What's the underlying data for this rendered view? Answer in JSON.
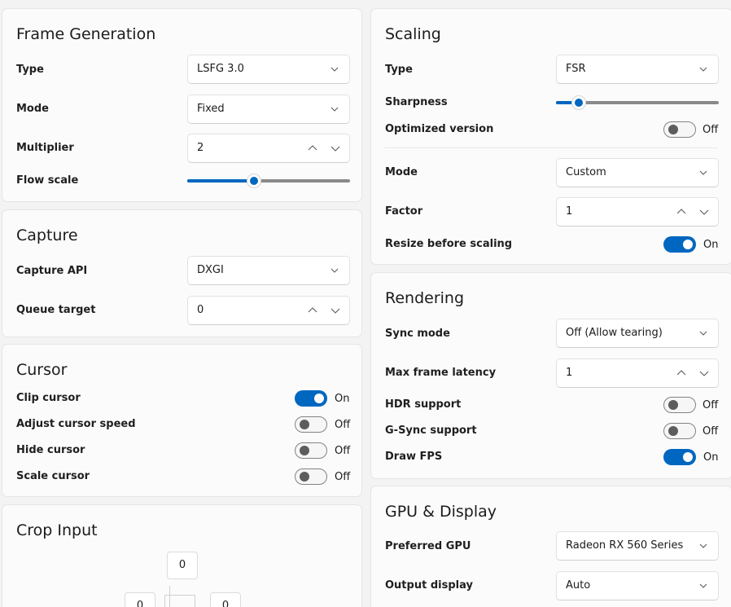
{
  "frame_generation": {
    "title": "Frame Generation",
    "type_label": "Type",
    "type_value": "LSFG 3.0",
    "mode_label": "Mode",
    "mode_value": "Fixed",
    "multiplier_label": "Multiplier",
    "multiplier_value": "2",
    "flow_scale_label": "Flow scale",
    "flow_scale_fraction": 0.41
  },
  "capture": {
    "title": "Capture",
    "api_label": "Capture API",
    "api_value": "DXGI",
    "queue_label": "Queue target",
    "queue_value": "0"
  },
  "cursor": {
    "title": "Cursor",
    "clip_label": "Clip cursor",
    "clip_state": "On",
    "adjust_label": "Adjust cursor speed",
    "adjust_state": "Off",
    "hide_label": "Hide cursor",
    "hide_state": "Off",
    "scale_label": "Scale cursor",
    "scale_state": "Off"
  },
  "crop_input": {
    "title": "Crop Input",
    "top_value": "0",
    "left_value": "0",
    "right_value": "0"
  },
  "scaling": {
    "title": "Scaling",
    "type_label": "Type",
    "type_value": "FSR",
    "sharpness_label": "Sharpness",
    "sharpness_fraction": 0.14,
    "optimized_label": "Optimized version",
    "optimized_state": "Off",
    "mode_label": "Mode",
    "mode_value": "Custom",
    "factor_label": "Factor",
    "factor_value": "1",
    "resize_label": "Resize before scaling",
    "resize_state": "On"
  },
  "rendering": {
    "title": "Rendering",
    "sync_label": "Sync mode",
    "sync_value": "Off (Allow tearing)",
    "latency_label": "Max frame latency",
    "latency_value": "1",
    "hdr_label": "HDR support",
    "hdr_state": "Off",
    "gsync_label": "G-Sync support",
    "gsync_state": "Off",
    "fps_label": "Draw FPS",
    "fps_state": "On"
  },
  "gpu_display": {
    "title": "GPU & Display",
    "gpu_label": "Preferred GPU",
    "gpu_value": "Radeon RX 560 Series",
    "output_label": "Output display",
    "output_value": "Auto"
  },
  "colors": {
    "accent": "#0067c0",
    "card": "#fbfbfb",
    "background": "#f3f3f3"
  },
  "icons": {
    "dropdown": "chevron-down-icon",
    "stepper_up": "chevron-up-icon",
    "stepper_down": "chevron-down-icon"
  }
}
